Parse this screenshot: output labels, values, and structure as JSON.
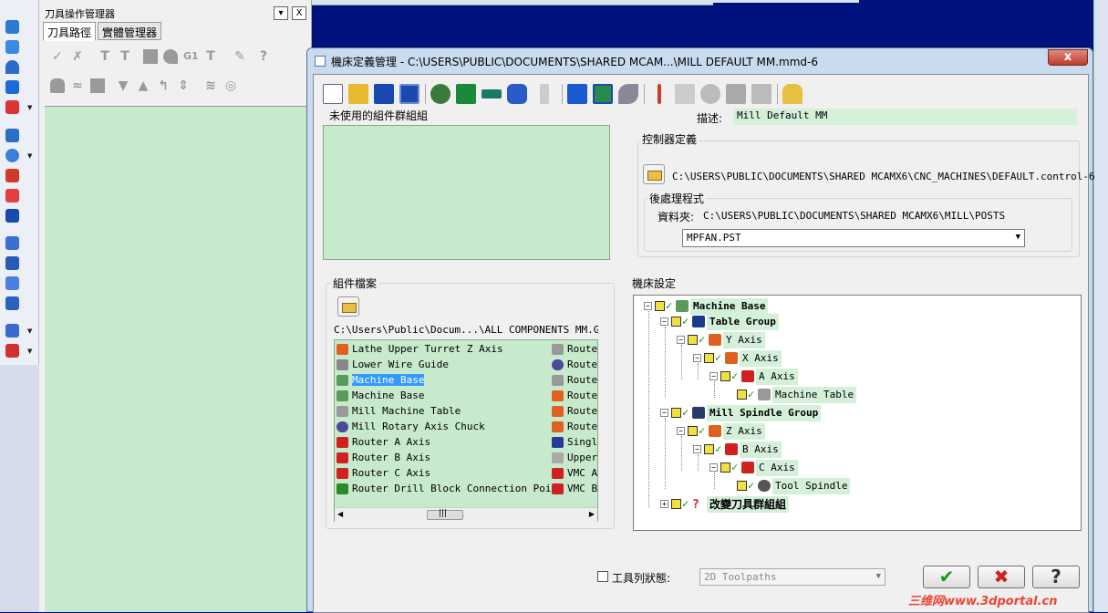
{
  "manager": {
    "title": "刀具操作管理器",
    "tabs": [
      "刀具路徑",
      "實體管理器"
    ],
    "min_btn": "▾",
    "close_btn": "X"
  },
  "toolbar_glyphs": {
    "g1": "G1",
    "help": "?"
  },
  "dialog": {
    "title": "機床定義管理 - C:\\USERS\\PUBLIC\\DOCUMENTS\\SHARED MCAM...\\MILL DEFAULT MM.mmd-6",
    "close_label": "x",
    "unused_group_label": "未使用的組件群組組",
    "description_label": "描述:",
    "description_value": "Mill Default MM",
    "controller_label": "控制器定義",
    "controller_path": "C:\\USERS\\PUBLIC\\DOCUMENTS\\SHARED MCAMX6\\CNC_MACHINES\\DEFAULT.control-6",
    "post_label": "後處理程式",
    "post_folder_label": "資料夾:",
    "post_folder_path": "C:\\USERS\\PUBLIC\\DOCUMENTS\\SHARED MCAMX6\\MILL\\POSTS",
    "post_selected": "MPFAN.PST",
    "component_files_label": "組件檔案",
    "component_path": "C:\\Users\\Public\\Docum...\\ALL COMPONENTS MM.GMD-6",
    "component_items": [
      "Lathe Upper Turret Z Axis",
      "Lower Wire Guide",
      "Machine Base",
      "Machine Base",
      "Mill Machine Table",
      "Mill Rotary Axis Chuck",
      "Router A Axis",
      "Router B Axis",
      "Router C Axis",
      "Router Drill Block Connection Point"
    ],
    "component_items_col2": [
      "Route",
      "Route",
      "Route",
      "Route",
      "Route",
      "Route",
      "Singl",
      "Upper",
      "VMC A",
      "VMC B"
    ],
    "scroll_thumb": "|||",
    "machine_settings_label": "機床設定",
    "tree": [
      "Machine Base",
      "Table Group",
      "Y Axis",
      "X Axis",
      "A Axis",
      "Machine Table",
      "Mill Spindle Group",
      "Z Axis",
      "B Axis",
      "C Axis",
      "Tool Spindle",
      "改變刀具群組組"
    ],
    "toolbar_state_label": "工具列狀態:",
    "toolbar_state_value": "2D Toolpaths",
    "ok_glyph": "✔",
    "cancel_glyph": "✖",
    "help_glyph": "?"
  },
  "watermark": "三维网www.3dportal.cn",
  "colors": {
    "desktop": "#00127e",
    "panel_green": "#c7e9cc",
    "label_green": "#d4f0d8",
    "selection": "#3399ff"
  }
}
